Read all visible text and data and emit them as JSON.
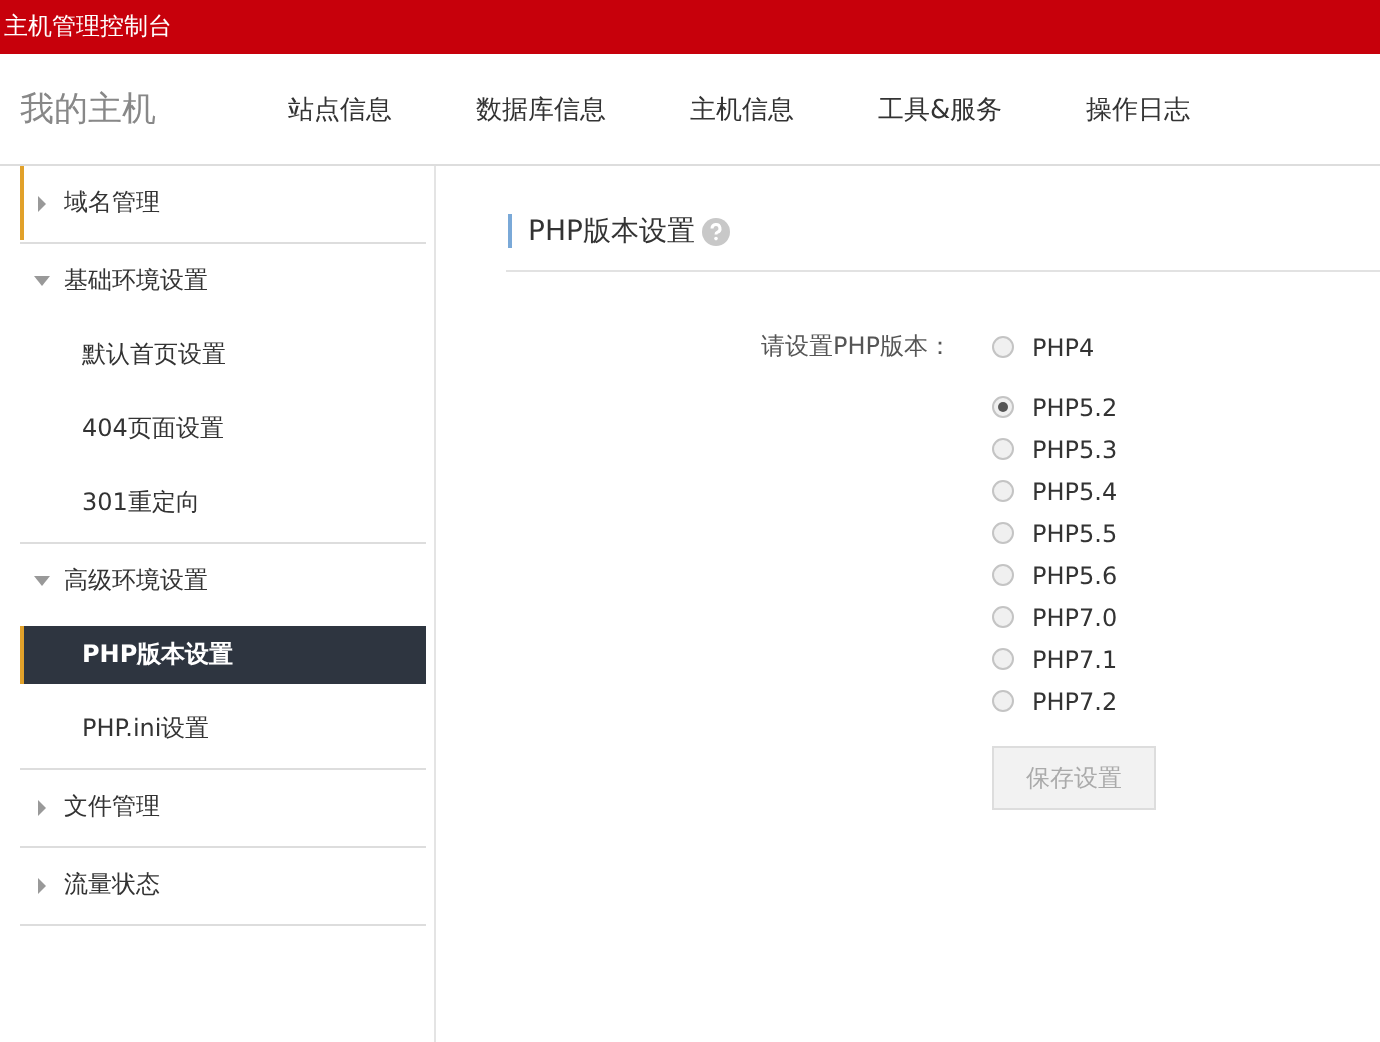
{
  "topbar": {
    "title": "主机管理控制台"
  },
  "header": {
    "brand": "我的主机",
    "nav": [
      {
        "label": "站点信息",
        "selected": false
      },
      {
        "label": "数据库信息",
        "selected": false
      },
      {
        "label": "主机信息",
        "selected": false
      },
      {
        "label": "工具&服务",
        "selected": false
      },
      {
        "label": "操作日志",
        "selected": false
      }
    ]
  },
  "sidebar": {
    "groups": [
      {
        "label": "域名管理",
        "expanded": false,
        "selected": true
      },
      {
        "label": "基础环境设置",
        "expanded": true,
        "selected": false,
        "children": [
          {
            "label": "默认首页设置",
            "selected": false
          },
          {
            "label": "404页面设置",
            "selected": false
          },
          {
            "label": "301重定向",
            "selected": false
          }
        ]
      },
      {
        "label": "高级环境设置",
        "expanded": true,
        "selected": false,
        "children": [
          {
            "label": "PHP版本设置",
            "selected": true
          },
          {
            "label": "PHP.ini设置",
            "selected": false
          }
        ]
      },
      {
        "label": "文件管理",
        "expanded": false,
        "selected": false
      },
      {
        "label": "流量状态",
        "expanded": false,
        "selected": false
      }
    ]
  },
  "main": {
    "title": "PHP版本设置",
    "form_label": "请设置PHP版本：",
    "options": [
      {
        "label": "PHP4",
        "selected": false
      },
      {
        "label": "PHP5.2",
        "selected": true
      },
      {
        "label": "PHP5.3",
        "selected": false
      },
      {
        "label": "PHP5.4",
        "selected": false
      },
      {
        "label": "PHP5.5",
        "selected": false
      },
      {
        "label": "PHP5.6",
        "selected": false
      },
      {
        "label": "PHP7.0",
        "selected": false
      },
      {
        "label": "PHP7.1",
        "selected": false
      },
      {
        "label": "PHP7.2",
        "selected": false
      }
    ],
    "save_button": {
      "label": "保存设置",
      "disabled": true
    }
  }
}
